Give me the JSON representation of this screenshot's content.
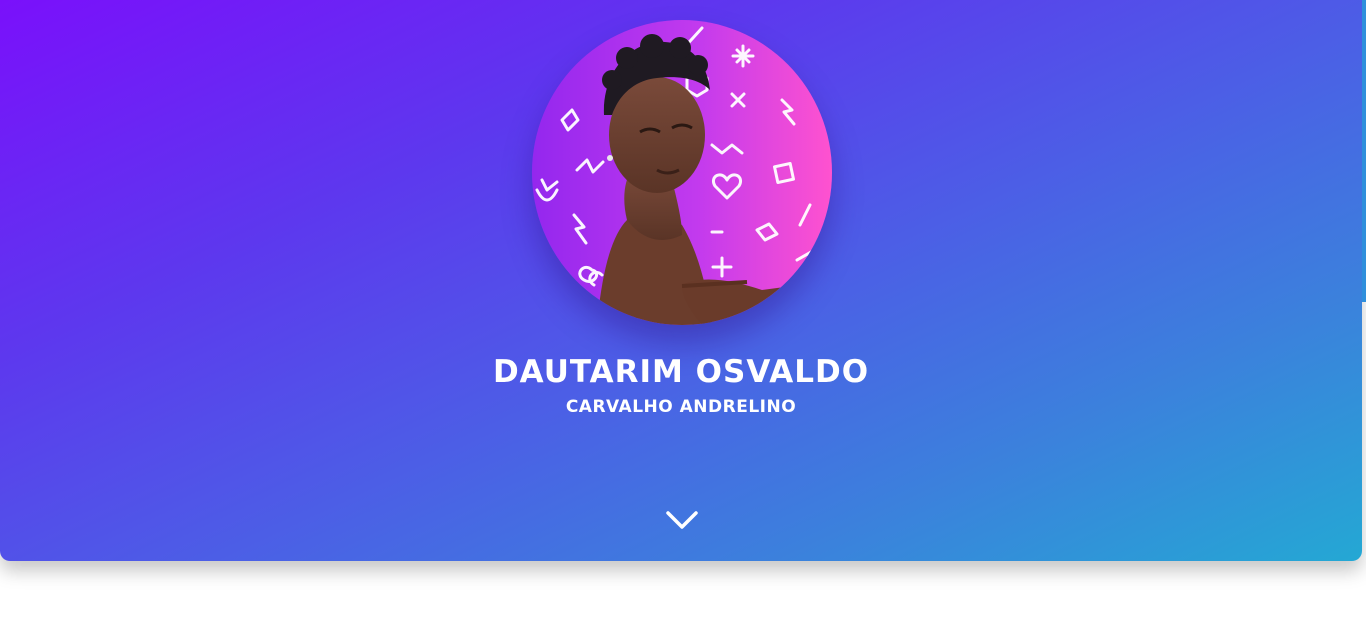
{
  "profile": {
    "first_name": "DAUTARIM OSVALDO",
    "last_name": "CARVALHO ANDRELINO",
    "avatar_alt": "profile photo"
  },
  "icons": {
    "scroll": "chevron-down-icon"
  },
  "colors": {
    "gradient_start": "#7a10fb",
    "gradient_mid": "#4c5ee6",
    "gradient_end": "#24a8d4",
    "avatar_bg_left": "#9b2cf2",
    "avatar_bg_right": "#ff4fd2",
    "text": "#ffffff"
  }
}
